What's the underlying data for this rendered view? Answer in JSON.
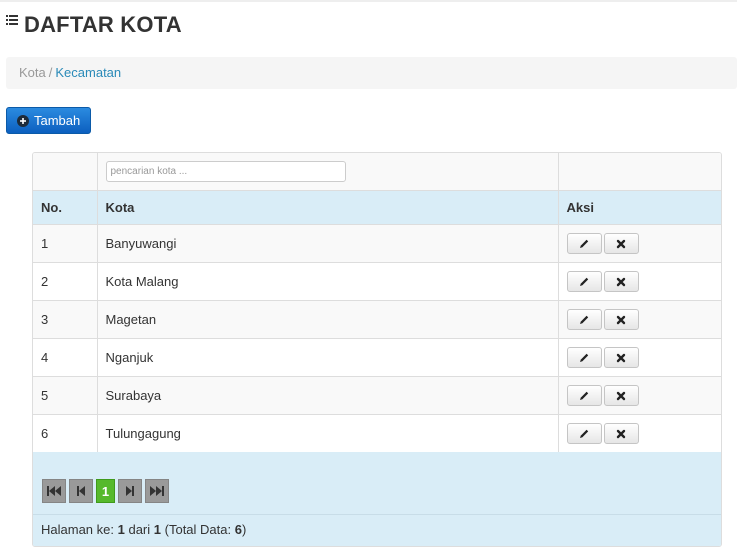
{
  "page": {
    "title": "DAFTAR KOTA"
  },
  "breadcrumb": {
    "home": "Kota",
    "separator": "/",
    "current": "Kecamatan"
  },
  "toolbar": {
    "add_label": "Tambah"
  },
  "search": {
    "placeholder": "pencarian kota ..."
  },
  "table": {
    "headers": {
      "no": "No.",
      "kota": "Kota",
      "aksi": "Aksi"
    },
    "rows": [
      {
        "no": "1",
        "kota": "Banyuwangi"
      },
      {
        "no": "2",
        "kota": "Kota Malang"
      },
      {
        "no": "3",
        "kota": "Magetan"
      },
      {
        "no": "4",
        "kota": "Nganjuk"
      },
      {
        "no": "5",
        "kota": "Surabaya"
      },
      {
        "no": "6",
        "kota": "Tulungagung"
      }
    ]
  },
  "pagination": {
    "current_page": "1"
  },
  "footer": {
    "prefix": "Halaman ke:",
    "page": "1",
    "of_label": "dari",
    "total_pages": "1",
    "total_prefix": "(Total Data:",
    "total": "6",
    "total_suffix": ")"
  },
  "colors": {
    "accent": "#0c5fbf",
    "header_bg": "#d9edf7",
    "active_page": "#56b92c",
    "link": "#2a8ab8"
  },
  "icons": {
    "title": "list-icon",
    "add": "plus-circle-icon",
    "edit": "pencil-icon",
    "delete": "close-icon"
  }
}
